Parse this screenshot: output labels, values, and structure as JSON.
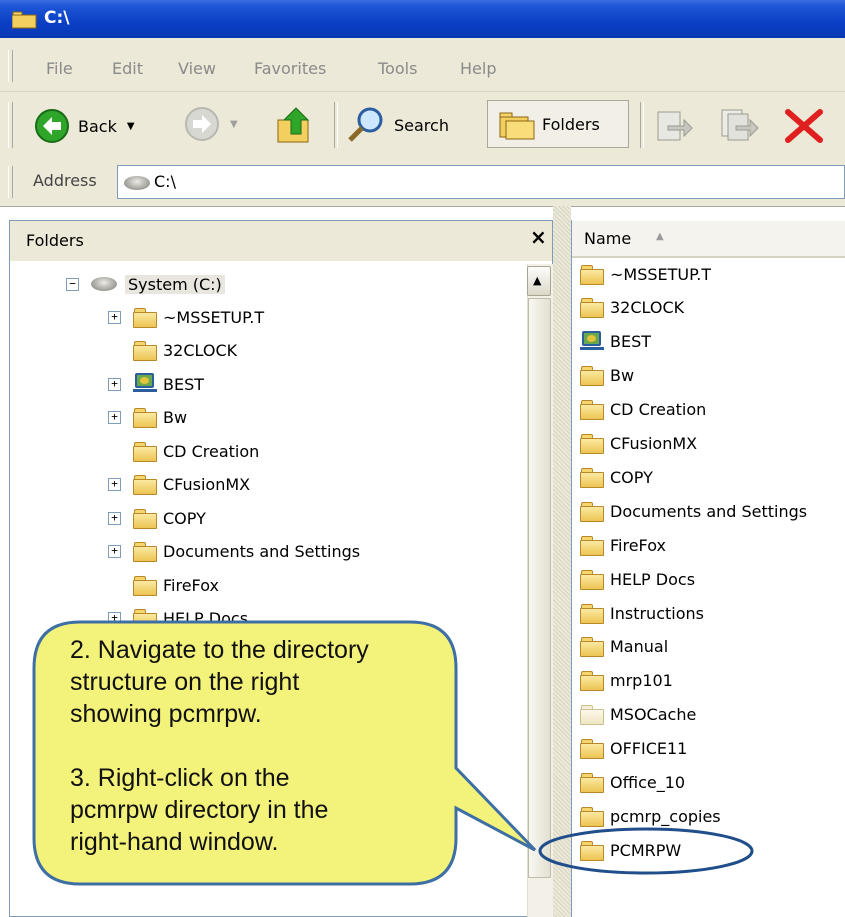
{
  "window": {
    "title": "C:\\"
  },
  "menu": [
    "File",
    "Edit",
    "View",
    "Favorites",
    "Tools",
    "Help"
  ],
  "toolbar": {
    "back": "Back",
    "search": "Search",
    "folders": "Folders"
  },
  "address": {
    "label": "Address",
    "value": "C:\\"
  },
  "folders_pane": {
    "title": "Folders",
    "root": "System (C:)",
    "items": [
      {
        "label": "~MSSETUP.T",
        "expandable": true,
        "icon": "folder"
      },
      {
        "label": "32CLOCK",
        "expandable": false,
        "icon": "folder"
      },
      {
        "label": "BEST",
        "expandable": true,
        "icon": "network-computer"
      },
      {
        "label": "Bw",
        "expandable": true,
        "icon": "folder"
      },
      {
        "label": "CD Creation",
        "expandable": false,
        "icon": "folder"
      },
      {
        "label": "CFusionMX",
        "expandable": true,
        "icon": "folder"
      },
      {
        "label": "COPY",
        "expandable": true,
        "icon": "folder"
      },
      {
        "label": "Documents and Settings",
        "expandable": true,
        "icon": "folder"
      },
      {
        "label": "FireFox",
        "expandable": false,
        "icon": "folder"
      },
      {
        "label": "HELP Docs",
        "expandable": true,
        "icon": "folder"
      }
    ]
  },
  "files_pane": {
    "column_name": "Name",
    "items": [
      {
        "label": "~MSSETUP.T",
        "icon": "folder"
      },
      {
        "label": "32CLOCK",
        "icon": "folder"
      },
      {
        "label": "BEST",
        "icon": "network-computer"
      },
      {
        "label": "Bw",
        "icon": "folder"
      },
      {
        "label": "CD Creation",
        "icon": "folder"
      },
      {
        "label": "CFusionMX",
        "icon": "folder"
      },
      {
        "label": "COPY",
        "icon": "folder"
      },
      {
        "label": "Documents and Settings",
        "icon": "folder"
      },
      {
        "label": "FireFox",
        "icon": "folder"
      },
      {
        "label": "HELP Docs",
        "icon": "folder"
      },
      {
        "label": "Instructions",
        "icon": "folder"
      },
      {
        "label": "Manual",
        "icon": "folder"
      },
      {
        "label": "mrp101",
        "icon": "folder"
      },
      {
        "label": "MSOCache",
        "icon": "folder-hidden"
      },
      {
        "label": "OFFICE11",
        "icon": "folder"
      },
      {
        "label": "Office_10",
        "icon": "folder"
      },
      {
        "label": "pcmrp_copies",
        "icon": "folder"
      },
      {
        "label": "PCMRPW",
        "icon": "folder"
      }
    ]
  },
  "callout": {
    "step2_line1": "2. Navigate to the directory",
    "step2_line2": "structure on the right",
    "step2_line3": "showing pcmrpw.",
    "step3_line1": "3. Right-click on the",
    "step3_line2": "pcmrpw directory in the",
    "step3_line3": "right-hand window."
  },
  "colors": {
    "title_bar": "#0a3fc6",
    "chrome": "#ece9d8",
    "callout_fill": "#f3f27a",
    "callout_border": "#3d6fa5",
    "close_red": "#e02020"
  }
}
